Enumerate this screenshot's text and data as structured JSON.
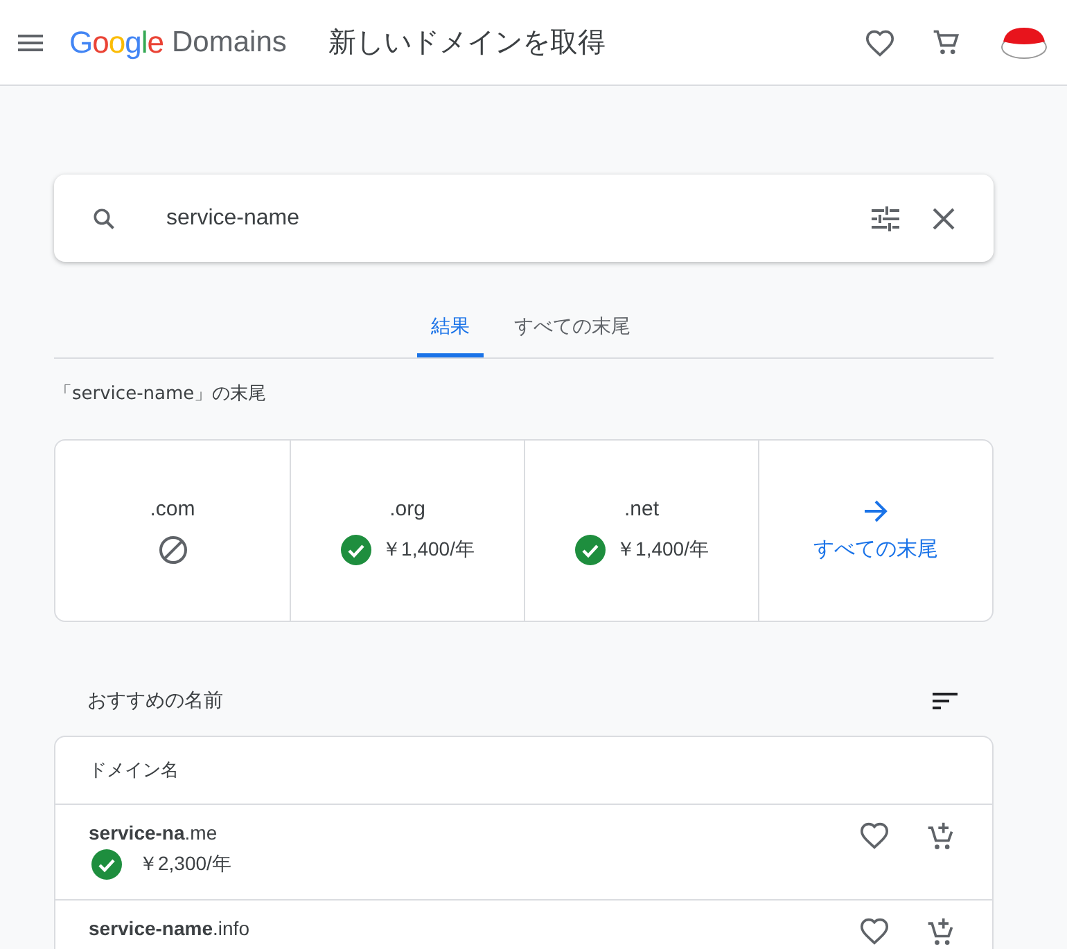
{
  "header": {
    "logo_brand": "Google",
    "logo_product": "Domains",
    "title": "新しいドメインを取得"
  },
  "search": {
    "value": "service-name"
  },
  "tabs": [
    {
      "label": "結果",
      "selected": true
    },
    {
      "label": "すべての末尾",
      "selected": false
    }
  ],
  "endings_heading": "「service-name」の末尾",
  "endings": [
    {
      "kind": "unavailable",
      "name": ".com"
    },
    {
      "kind": "available",
      "name": ".org",
      "price": "￥1,400/年"
    },
    {
      "kind": "available",
      "name": ".net",
      "price": "￥1,400/年"
    },
    {
      "kind": "link",
      "label": "すべての末尾"
    }
  ],
  "suggestions_heading": "おすすめの名前",
  "table": {
    "column": "ドメイン名",
    "rows": [
      {
        "domain": "**service-na**.me",
        "available": true,
        "price": "￥2,300/年"
      },
      {
        "domain": "**service-name**.info"
      }
    ]
  }
}
